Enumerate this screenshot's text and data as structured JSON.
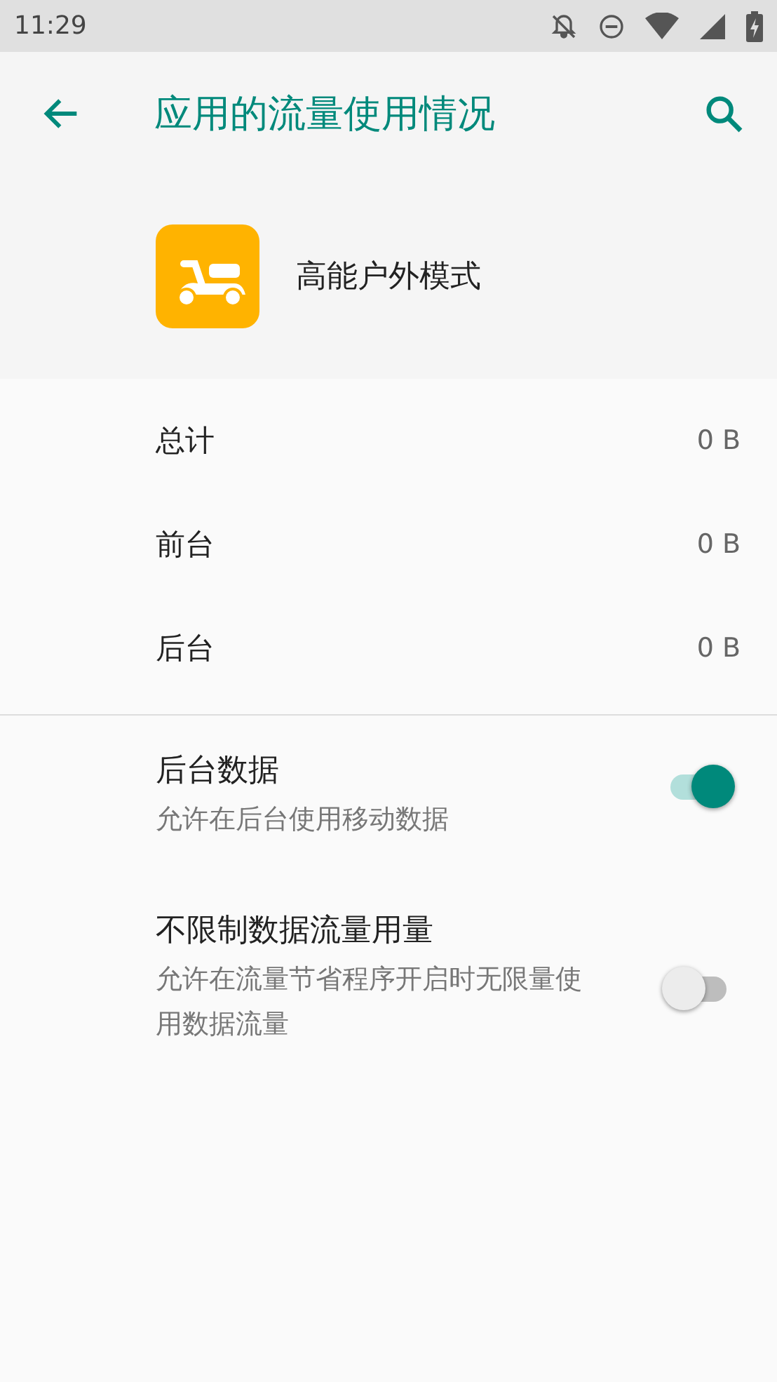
{
  "status_bar": {
    "time": "11:29"
  },
  "toolbar": {
    "title": "应用的流量使用情况"
  },
  "app": {
    "name": "高能户外模式"
  },
  "usage": [
    {
      "label": "总计",
      "value": "0 B"
    },
    {
      "label": "前台",
      "value": "0 B"
    },
    {
      "label": "后台",
      "value": "0 B"
    }
  ],
  "settings": [
    {
      "title": "后台数据",
      "summary": "允许在后台使用移动数据",
      "on": true
    },
    {
      "title": "不限制数据流量用量",
      "summary": "允许在流量节省程序开启时无限量使用数据流量",
      "on": false
    }
  ]
}
